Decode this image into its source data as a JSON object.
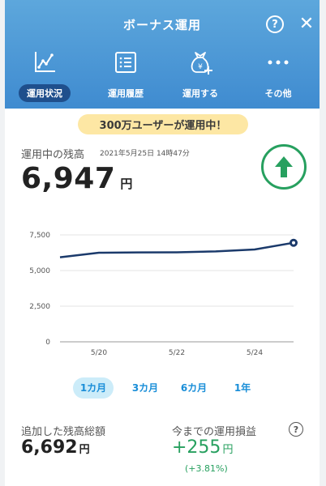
{
  "header": {
    "title": "ボーナス運用",
    "help_icon": "?",
    "close_icon": "✕"
  },
  "tabs": [
    {
      "label": "運用状況",
      "icon": "chart-icon",
      "active": true
    },
    {
      "label": "運用履歴",
      "icon": "list-icon",
      "active": false
    },
    {
      "label": "運用する",
      "icon": "money-bag-plus-icon",
      "active": false
    },
    {
      "label": "その他",
      "icon": "more-icon",
      "active": false
    }
  ],
  "banner": {
    "text": "300万ユーザーが運用中！"
  },
  "balance": {
    "label": "運用中の残高",
    "timestamp": "2021年5月25日 14時47分",
    "value": "6,947",
    "unit": "円",
    "trend_icon": "arrow-up-icon",
    "trend_color": "#27a05f"
  },
  "chart_data": {
    "type": "line",
    "x": [
      "5/19",
      "5/20",
      "5/21",
      "5/22",
      "5/23",
      "5/24",
      "5/25"
    ],
    "x_tick_labels": [
      "5/20",
      "5/22",
      "5/24"
    ],
    "series": [
      {
        "values": [
          5930,
          6250,
          6270,
          6280,
          6340,
          6480,
          6947
        ]
      }
    ],
    "ylim": [
      0,
      7500
    ],
    "y_tick_labels": [
      "0",
      "2,500",
      "5,000",
      "7,500"
    ],
    "line_color": "#1b3a6b",
    "grid": true
  },
  "periods": [
    {
      "label": "1カ月",
      "active": true
    },
    {
      "label": "3カ月",
      "active": false
    },
    {
      "label": "6カ月",
      "active": false
    },
    {
      "label": "1年",
      "active": false
    }
  ],
  "summary": {
    "total_label": "追加した残高総額",
    "total_value": "6,692",
    "total_unit": "円",
    "pl_label": "今までの運用損益",
    "pl_value": "+255",
    "pl_unit": "円",
    "pl_percent": "(+3.81%)",
    "help_icon": "?",
    "positive_color": "#27a05f"
  },
  "colors": {
    "header_blue": "#4a97d6",
    "active_tab": "#1f4f8c",
    "banner": "#fde7a4",
    "period_active_bg": "#ccecf9",
    "period_text": "#1a8ed8"
  }
}
